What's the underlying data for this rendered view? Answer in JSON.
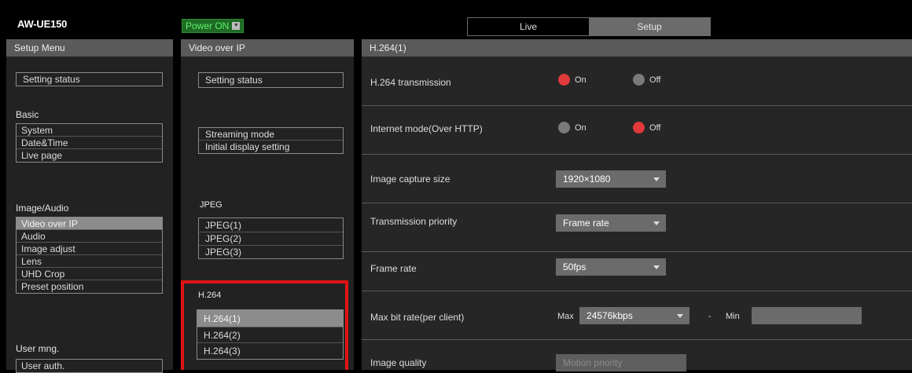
{
  "header": {
    "model": "AW-UE150",
    "power_label": "Power ON",
    "tabs": [
      {
        "label": "Live"
      },
      {
        "label": "Setup"
      }
    ]
  },
  "setup_menu": {
    "title": "Setup Menu",
    "setting_status": "Setting status",
    "sections": {
      "basic": {
        "title": "Basic",
        "items": [
          "System",
          "Date&Time",
          "Live page"
        ]
      },
      "image_audio": {
        "title": "Image/Audio",
        "items": [
          "Video over IP",
          "Audio",
          "Image adjust",
          "Lens",
          "UHD Crop",
          "Preset position"
        ]
      },
      "user_mng": {
        "title": "User mng.",
        "items": [
          "User auth."
        ]
      }
    }
  },
  "video_over_ip": {
    "title": "Video over IP",
    "setting_status": "Setting status",
    "items": [
      "Streaming mode",
      "Initial display setting"
    ],
    "jpeg": {
      "title": "JPEG",
      "items": [
        "JPEG(1)",
        "JPEG(2)",
        "JPEG(3)"
      ]
    },
    "h264": {
      "title": "H.264",
      "items": [
        "H.264(1)",
        "H.264(2)",
        "H.264(3)"
      ]
    }
  },
  "h264_panel": {
    "title": "H.264(1)",
    "transmission": {
      "label": "H.264 transmission",
      "on": "On",
      "off": "Off",
      "selected": "On"
    },
    "internet_mode": {
      "label": "Internet mode(Over HTTP)",
      "on": "On",
      "off": "Off",
      "selected": "Off"
    },
    "capture_size": {
      "label": "Image capture size",
      "value": "1920×1080"
    },
    "priority": {
      "label": "Transmission priority",
      "value": "Frame rate"
    },
    "frame_rate": {
      "label": "Frame rate",
      "value": "50fps"
    },
    "max_bit_rate": {
      "label": "Max bit rate(per client)",
      "max_label": "Max",
      "max_value": "24576kbps",
      "dash": "-",
      "min_label": "Min"
    },
    "image_quality": {
      "label": "Image quality",
      "value": "Motion priority"
    }
  },
  "colors": {
    "accent_red": "#e03a3a",
    "highlight_red": "#e01414",
    "power_green": "#1f6b25"
  }
}
